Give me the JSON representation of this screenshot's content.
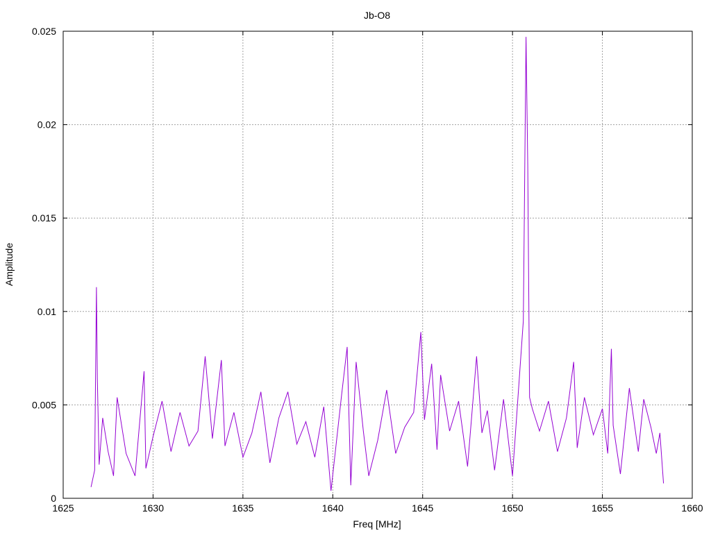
{
  "chart_data": {
    "type": "line",
    "title": "Jb-O8",
    "xlabel": "Freq [MHz]",
    "ylabel": "Amplitude",
    "xlim": [
      1625,
      1660
    ],
    "ylim": [
      0,
      0.025
    ],
    "x_ticks": [
      1625,
      1630,
      1635,
      1640,
      1645,
      1650,
      1655,
      1660
    ],
    "x_tick_labels": [
      "1625",
      "1630",
      "1635",
      "1640",
      "1645",
      "1650",
      "1655",
      "1660"
    ],
    "y_ticks": [
      0,
      0.005,
      0.01,
      0.015,
      0.02,
      0.025
    ],
    "y_tick_labels": [
      "0",
      "0.005",
      "0.01",
      "0.015",
      "0.02",
      "0.025"
    ],
    "grid": true,
    "legend": "none",
    "series_color": "#9400d3",
    "series": [
      {
        "x": [
          1626.55,
          1626.75,
          1626.85,
          1626.9,
          1627.0,
          1627.2,
          1627.5,
          1627.8,
          1628.0,
          1628.5,
          1629.0,
          1629.5,
          1629.6,
          1630.0,
          1630.5,
          1631.0,
          1631.5,
          1632.0,
          1632.5,
          1632.9,
          1633.3,
          1633.8,
          1634.0,
          1634.5,
          1635.0,
          1635.5,
          1636.0,
          1636.5,
          1637.0,
          1637.5,
          1638.0,
          1638.5,
          1639.0,
          1639.5,
          1639.9,
          1640.5,
          1640.8,
          1641.0,
          1641.3,
          1641.7,
          1642.0,
          1642.5,
          1643.0,
          1643.5,
          1644.0,
          1644.5,
          1644.9,
          1645.1,
          1645.5,
          1645.8,
          1646.0,
          1646.5,
          1647.0,
          1647.5,
          1648.0,
          1648.3,
          1648.6,
          1649.0,
          1649.5,
          1650.0,
          1650.6,
          1650.75,
          1650.85,
          1650.95,
          1651.1,
          1651.5,
          1652.0,
          1652.5,
          1653.0,
          1653.4,
          1653.6,
          1654.0,
          1654.5,
          1655.0,
          1655.3,
          1655.5,
          1655.6,
          1656.0,
          1656.5,
          1657.0,
          1657.3,
          1657.7,
          1658.0,
          1658.2,
          1658.4
        ],
        "y": [
          0.0006,
          0.0015,
          0.0113,
          0.0064,
          0.0018,
          0.0043,
          0.0025,
          0.0012,
          0.0054,
          0.0024,
          0.0012,
          0.0068,
          0.0016,
          0.0033,
          0.0052,
          0.0025,
          0.0046,
          0.0028,
          0.0036,
          0.0076,
          0.0032,
          0.0074,
          0.0028,
          0.0046,
          0.0022,
          0.0035,
          0.0057,
          0.0019,
          0.0043,
          0.0057,
          0.0029,
          0.0041,
          0.0022,
          0.0049,
          0.0004,
          0.0056,
          0.0081,
          0.0007,
          0.0073,
          0.0036,
          0.0012,
          0.0031,
          0.0058,
          0.0024,
          0.0038,
          0.0046,
          0.0089,
          0.0042,
          0.0072,
          0.0026,
          0.0066,
          0.0036,
          0.0052,
          0.0017,
          0.0076,
          0.0035,
          0.0047,
          0.0015,
          0.0053,
          0.0012,
          0.0095,
          0.0247,
          0.0178,
          0.0054,
          0.0048,
          0.0036,
          0.0052,
          0.0025,
          0.0043,
          0.0073,
          0.0027,
          0.0054,
          0.0034,
          0.0048,
          0.0024,
          0.008,
          0.0039,
          0.0013,
          0.0059,
          0.0025,
          0.0053,
          0.0038,
          0.0024,
          0.0035,
          0.0008
        ]
      }
    ]
  }
}
